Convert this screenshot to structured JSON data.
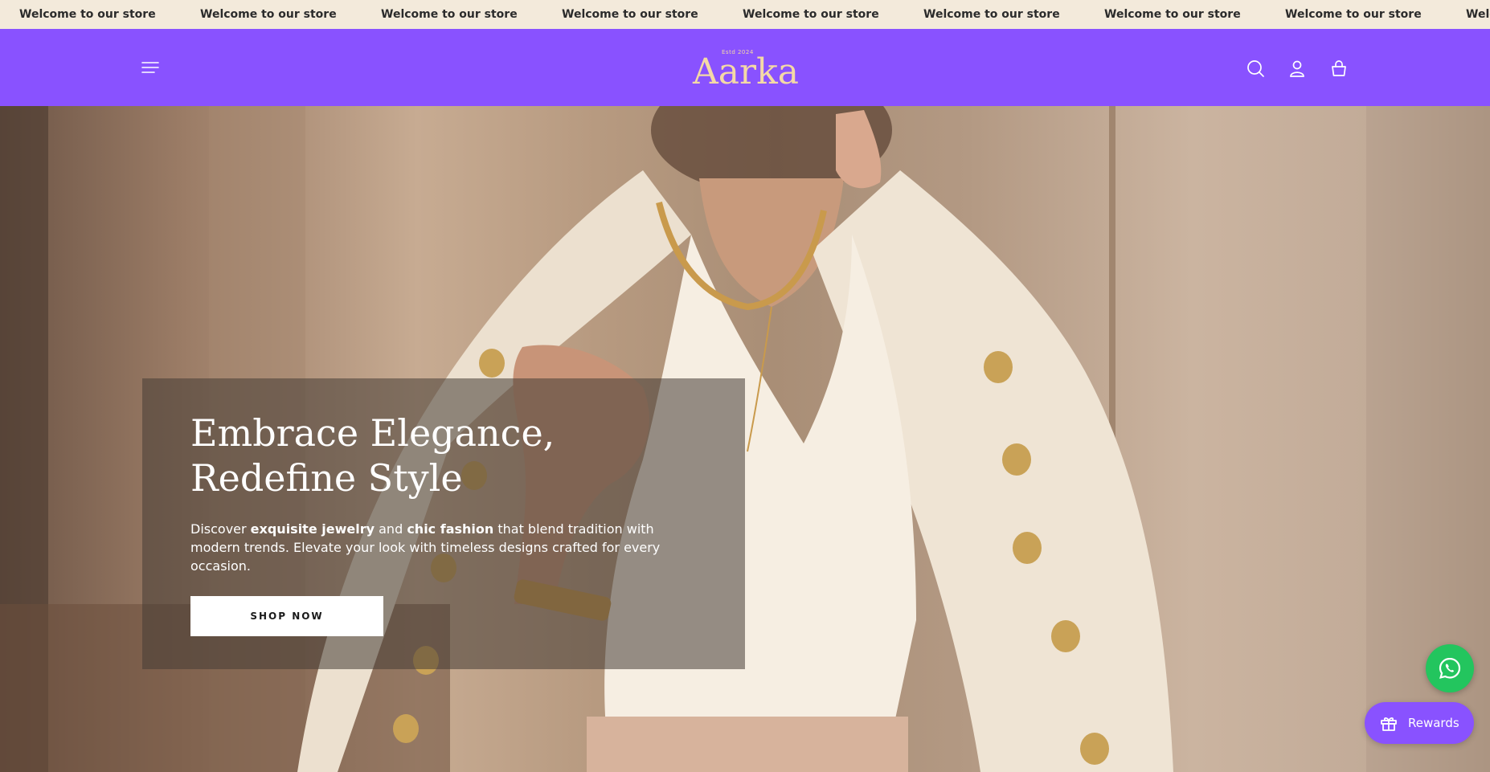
{
  "announcement": {
    "items": [
      "Welcome to our store",
      "Welcome to our store",
      "Welcome to our store",
      "Welcome to our store",
      "Welcome to our store",
      "Welcome to our store",
      "Welcome to our store",
      "Welcome to our store",
      "Welcome to our store"
    ]
  },
  "header": {
    "logo_text": "Aarka",
    "logo_estd": "Estd 2024",
    "menu_icon": "hamburger-menu-icon",
    "search_icon": "search-icon",
    "account_icon": "user-icon",
    "cart_icon": "shopping-bag-icon",
    "background_color": "#8952ff"
  },
  "hero": {
    "title_line1": "Embrace Elegance,",
    "title_line2": "Redefine Style",
    "desc_part1": "Discover ",
    "desc_bold1": "exquisite jewelry",
    "desc_part2": " and ",
    "desc_bold2": "chic fashion",
    "desc_part3": " that blend tradition with modern trends. Elevate your look with timeless designs crafted for every occasion.",
    "cta_label": "SHOP NOW"
  },
  "widgets": {
    "whatsapp_icon": "whatsapp-icon",
    "rewards_label": "Rewards",
    "rewards_icon": "gift-icon"
  },
  "colors": {
    "announcement_bg": "#f3eadb",
    "brand_purple": "#8952ff",
    "logo_gold": "#f4d9a6",
    "whatsapp_green": "#23c55e"
  }
}
